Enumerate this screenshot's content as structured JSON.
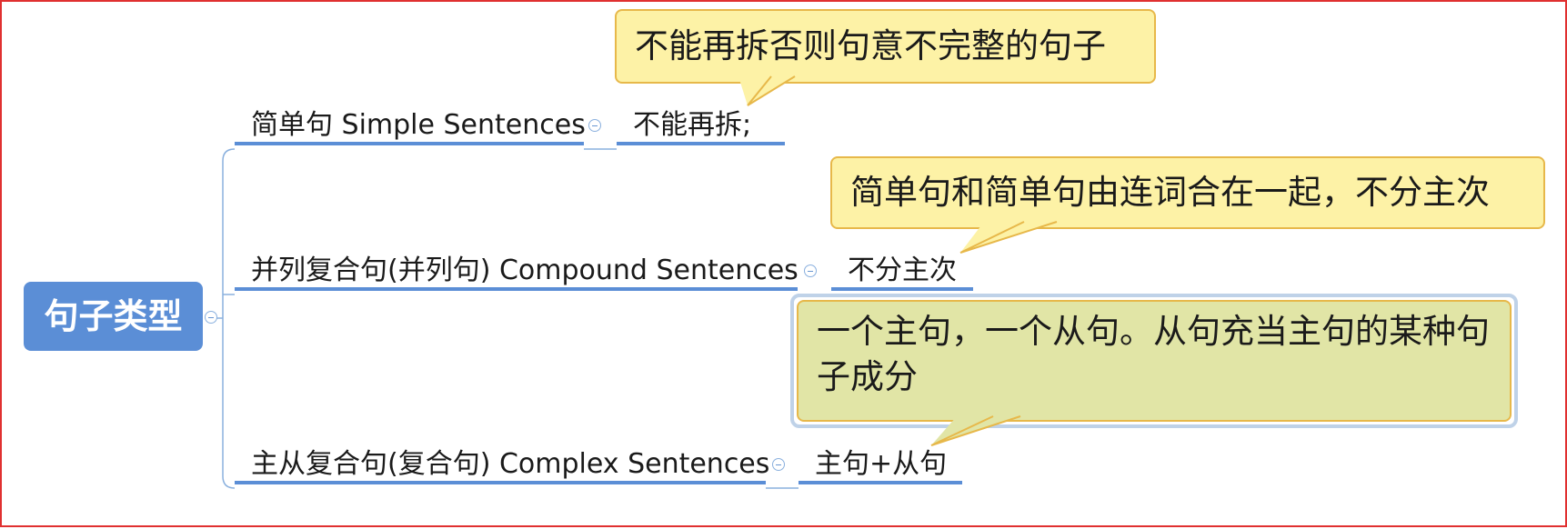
{
  "root": {
    "label": "句子类型"
  },
  "branches": [
    {
      "label": "简单句 Simple Sentences",
      "leaf": "不能再拆;",
      "note": "不能再拆否则句意不完整的句子"
    },
    {
      "label": "并列复合句(并列句) Compound Sentences",
      "leaf": "不分主次",
      "note": "简单句和简单句由连词合在一起，不分主次"
    },
    {
      "label": "主从复合句(复合句) Complex Sentences",
      "leaf": "主句+从句",
      "note": "一个主句，一个从句。从句充当主句的某种句子成分"
    }
  ],
  "colors": {
    "accent": "#5b8ed6",
    "connector": "#8ab0de",
    "callout_fill": "#fdf2a6",
    "callout_selected_fill": "#e1e5a6",
    "callout_border": "#e7b84a",
    "frame_border": "#e03030"
  }
}
